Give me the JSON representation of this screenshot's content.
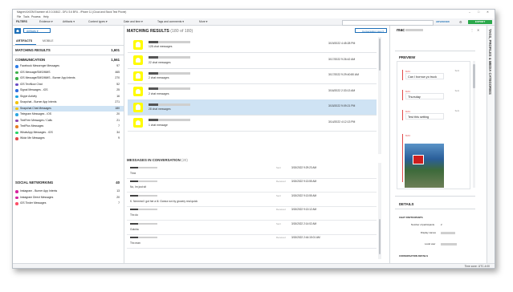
{
  "window": {
    "title": "Magnet AXIOM Examine v6.0.0.34612 - DFU 3.6 BFU - iPhone 11 (Cloud and Stock Test Phone)"
  },
  "menu": [
    "File",
    "Tools",
    "Process",
    "Help"
  ],
  "toolbar": {
    "filters_label": "FILTERS",
    "filter_evidence": "Evidence",
    "filter_artifacts": "Artifacts",
    "filter_content": "Content types",
    "filter_date": "Date and time",
    "filter_tags": "Tags and comments",
    "filter_more": "More",
    "search_placeholder": "",
    "advanced_label": "ADVANCED",
    "export_label": "EXPORT"
  },
  "left": {
    "dropdown": "Artifacts",
    "tab_artifacts": "ARTIFACTS",
    "tab_mobile": "MOBILE",
    "matching_label": "MATCHING RESULTS",
    "matching_count": "1,601",
    "comm_label": "COMMUNICATION",
    "comm_count": "1,561",
    "comm_items": [
      {
        "label": "Facebook Messenger Messages",
        "count": "97",
        "color": "#2b7de9"
      },
      {
        "label": "iOS Message/SMS/MMS",
        "count": "465",
        "color": "#3cb04a"
      },
      {
        "label": "iOS Message/SMS/MMS - Burner App Intents",
        "count": "270",
        "color": "#3cb04a"
      },
      {
        "label": "iOS TextNow Chat",
        "count": "52",
        "color": "#6a4bc4"
      },
      {
        "label": "Signal Messages - iOS",
        "count": "25",
        "color": "#2f6de0"
      },
      {
        "label": "Skype Activity",
        "count": "16",
        "color": "#1aa3e0"
      },
      {
        "label": "Snapchat - Burner App Intents",
        "count": "271",
        "color": "#f1c40f"
      },
      {
        "label": "Snapchat Chat Messages",
        "count": "180",
        "color": "#f1c40f"
      },
      {
        "label": "Telegram Messages - iOS",
        "count": "20",
        "color": "#2ca5e0"
      },
      {
        "label": "TextFree Messages / Calls",
        "count": "21",
        "color": "#8e44ad"
      },
      {
        "label": "TextPlus Messages",
        "count": "7",
        "color": "#e67e22"
      },
      {
        "label": "WhatsApp Messages - iOS",
        "count": "34",
        "color": "#25d366"
      },
      {
        "label": "Wickr Me Messages",
        "count": "9",
        "color": "#e24a4a"
      }
    ],
    "social_label": "SOCIAL NETWORKING",
    "social_count": "40",
    "social_items": [
      {
        "label": "Instagram - Burner App Intents",
        "count": "13",
        "color": "#d6249f"
      },
      {
        "label": "Instagram Direct Messages",
        "count": "20",
        "color": "#d6249f"
      },
      {
        "label": "iOS Tinder Messages",
        "count": "7",
        "color": "#fd5068"
      }
    ]
  },
  "center": {
    "title": "MATCHING RESULTS",
    "title_count": "(180 of 180)",
    "view_label": "Conversation view",
    "results": [
      {
        "count": "128 chat messages",
        "date": "3/19/2022 4:45:28 PM"
      },
      {
        "count": "22 chat messages",
        "date": "3/17/2022 9:26:42 AM"
      },
      {
        "count": "2 chat messages",
        "date": "3/17/2022 9:29:40:80 AM"
      },
      {
        "count": "2 chat messages",
        "date": "3/16/2022 2:33:13 AM"
      },
      {
        "count": "28 chat messages",
        "date": "3/15/2022 9:09:21 PM"
      },
      {
        "count": "1 chat message",
        "date": "3/14/2022 4:12:13 PM"
      }
    ],
    "mic_title": "MESSAGES IN CONVERSATION",
    "mic_count": "(20)",
    "messages": [
      {
        "dir": "Sent",
        "date": "3/15/2022 9:29:23 AM",
        "text": "Thnx"
      },
      {
        "dir": "Received",
        "date": "3/15/2022 9:13:55 AM",
        "text": "No, Im just sit"
      },
      {
        "dir": "Sent",
        "date": "3/15/2022 9:13:55 AM",
        "text": "K. Nmmmd I got her a lil. Gonna run by grocery real quick"
      },
      {
        "dir": "Received",
        "date": "3/15/2022 9:13:12 AM",
        "text": "Thx do"
      },
      {
        "dir": "Sent",
        "date": "3/15/2022 2:14:02 AM",
        "text": "Gotcha"
      },
      {
        "dir": "Received",
        "date": "3/15/2022 2:44:15:01 AM",
        "text": "Thx man"
      }
    ]
  },
  "right": {
    "name": "mac",
    "preview_label": "PREVIEW",
    "bubbles": [
      {
        "who": "MAC",
        "time": "Sent",
        "text": "Can I borrow yo truck"
      },
      {
        "who": "MAC",
        "time": "Sent",
        "text": "Thursday"
      },
      {
        "who": "MAC",
        "time": "Sent",
        "text": "Test this setting"
      }
    ],
    "details_label": "DETAILS",
    "chat_participants_label": "CHAT PARTICIPANTS",
    "num_participants_label": "Number of participants",
    "num_participants": "2",
    "display_names_label": "Display names",
    "local_user_label": "Local user",
    "conversation_details_label": "CONVERSATION DETAILS"
  },
  "vertical_tab": "TAGS, PROFILES & MEDIA CATEGORIES",
  "status": {
    "timezone": "Time zone: UTC-4:00"
  }
}
